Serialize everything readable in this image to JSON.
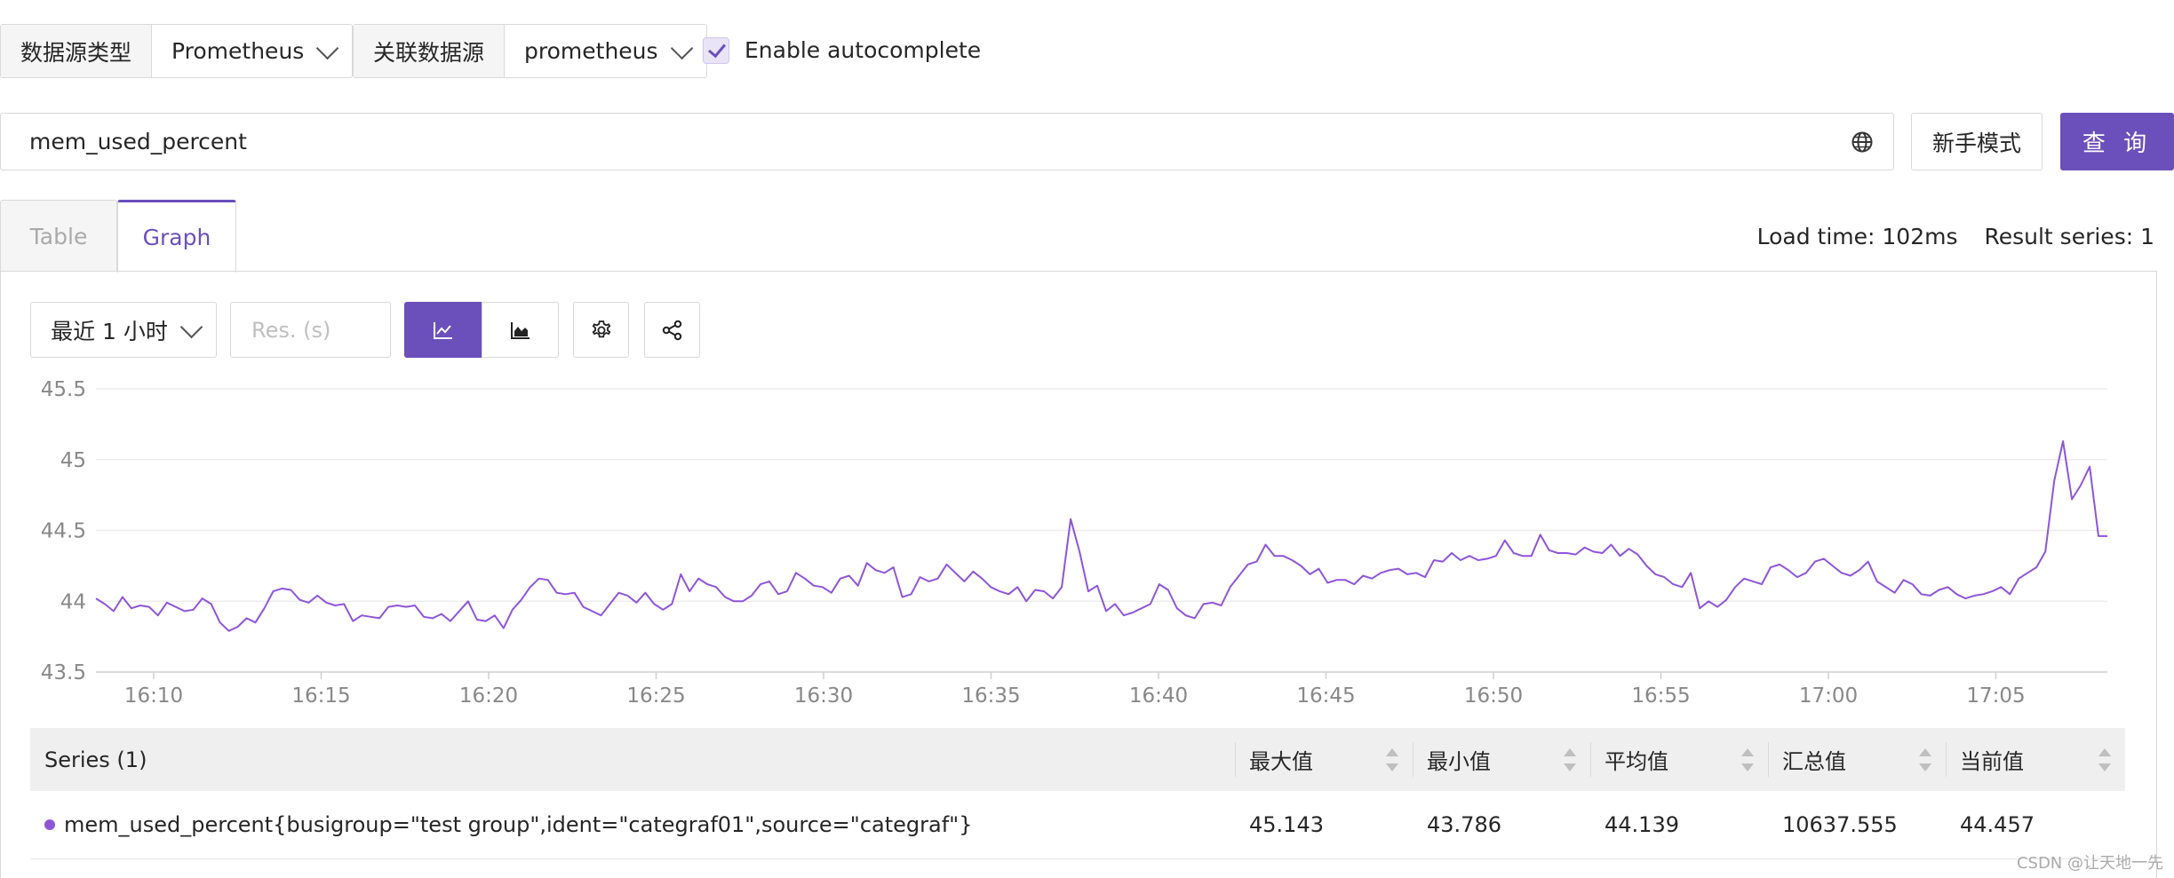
{
  "datasource": {
    "type_label": "数据源类型",
    "type_value": "Prometheus",
    "source_label": "关联数据源",
    "source_value": "prometheus",
    "autocomplete_label": "Enable autocomplete"
  },
  "query": {
    "value": "mem_used_percent",
    "novice_button": "新手模式",
    "query_button": "查 询"
  },
  "tabs": [
    {
      "label": "Table",
      "active": false
    },
    {
      "label": "Graph",
      "active": true
    }
  ],
  "stats": {
    "load_time": "Load time: 102ms",
    "result_series": "Result series: 1"
  },
  "toolbar": {
    "time_range": "最近 1 小时",
    "res_placeholder": "Res. (s)",
    "icons": [
      "line-chart-icon",
      "area-chart-icon",
      "gear-icon",
      "share-icon"
    ]
  },
  "chart_data": {
    "type": "line",
    "ylim": [
      43.5,
      45.5
    ],
    "yticks": [
      "45.5",
      "45",
      "44.5",
      "44",
      "43.5"
    ],
    "xticks": [
      "16:10",
      "16:15",
      "16:20",
      "16:25",
      "16:30",
      "16:35",
      "16:40",
      "16:45",
      "16:50",
      "16:55",
      "17:00",
      "17:05"
    ],
    "color": "#8e55d9",
    "grid": true,
    "series": [
      {
        "values": [
          44.02,
          43.98,
          43.93,
          44.03,
          43.95,
          43.97,
          43.96,
          43.9,
          43.99,
          43.96,
          43.93,
          43.94,
          44.02,
          43.98,
          43.85,
          43.79,
          43.82,
          43.88,
          43.85,
          43.95,
          44.07,
          44.09,
          44.08,
          44.01,
          43.99,
          44.04,
          43.99,
          43.97,
          43.98,
          43.86,
          43.9,
          43.89,
          43.88,
          43.96,
          43.97,
          43.96,
          43.97,
          43.89,
          43.88,
          43.91,
          43.86,
          43.93,
          44.0,
          43.87,
          43.86,
          43.9,
          43.81,
          43.94,
          44.01,
          44.1,
          44.16,
          44.15,
          44.06,
          44.05,
          44.06,
          43.96,
          43.93,
          43.9,
          43.98,
          44.06,
          44.04,
          43.99,
          44.06,
          43.98,
          43.94,
          43.98,
          44.19,
          44.07,
          44.16,
          44.12,
          44.1,
          44.03,
          44.0,
          44.0,
          44.04,
          44.12,
          44.14,
          44.05,
          44.07,
          44.2,
          44.16,
          44.11,
          44.1,
          44.06,
          44.16,
          44.18,
          44.11,
          44.27,
          44.22,
          44.2,
          44.24,
          44.03,
          44.05,
          44.17,
          44.14,
          44.16,
          44.26,
          44.2,
          44.14,
          44.21,
          44.16,
          44.1,
          44.07,
          44.05,
          44.1,
          44.0,
          44.08,
          44.07,
          44.02,
          44.1,
          44.58,
          44.35,
          44.07,
          44.11,
          43.93,
          43.98,
          43.9,
          43.92,
          43.95,
          43.98,
          44.12,
          44.08,
          43.95,
          43.9,
          43.88,
          43.98,
          43.99,
          43.97,
          44.1,
          44.18,
          44.26,
          44.28,
          44.4,
          44.32,
          44.32,
          44.29,
          44.25,
          44.19,
          44.23,
          44.13,
          44.15,
          44.15,
          44.12,
          44.18,
          44.16,
          44.2,
          44.22,
          44.23,
          44.19,
          44.2,
          44.17,
          44.29,
          44.28,
          44.34,
          44.29,
          44.32,
          44.29,
          44.3,
          44.32,
          44.43,
          44.34,
          44.32,
          44.32,
          44.47,
          44.36,
          44.34,
          44.34,
          44.33,
          44.38,
          44.35,
          44.34,
          44.4,
          44.32,
          44.37,
          44.33,
          44.25,
          44.19,
          44.17,
          44.12,
          44.1,
          44.2,
          43.95,
          44.0,
          43.96,
          44.01,
          44.1,
          44.16,
          44.14,
          44.12,
          44.24,
          44.26,
          44.22,
          44.17,
          44.2,
          44.28,
          44.3,
          44.25,
          44.2,
          44.18,
          44.22,
          44.28,
          44.14,
          44.1,
          44.06,
          44.15,
          44.12,
          44.05,
          44.04,
          44.08,
          44.1,
          44.05,
          44.02,
          44.04,
          44.05,
          44.07,
          44.1,
          44.05,
          44.16,
          44.2,
          44.24,
          44.35,
          44.85,
          45.13,
          44.72,
          44.82,
          44.95,
          44.46,
          44.46
        ]
      }
    ]
  },
  "table": {
    "headers": [
      "Series (1)",
      "最大值",
      "最小值",
      "平均值",
      "汇总值",
      "当前值"
    ],
    "rows": [
      {
        "series": "mem_used_percent{busigroup=\"test group\",ident=\"categraf01\",source=\"categraf\"}",
        "max": "45.143",
        "min": "43.786",
        "avg": "44.139",
        "sum": "10637.555",
        "current": "44.457"
      }
    ]
  },
  "watermark": "CSDN @让天地一先"
}
